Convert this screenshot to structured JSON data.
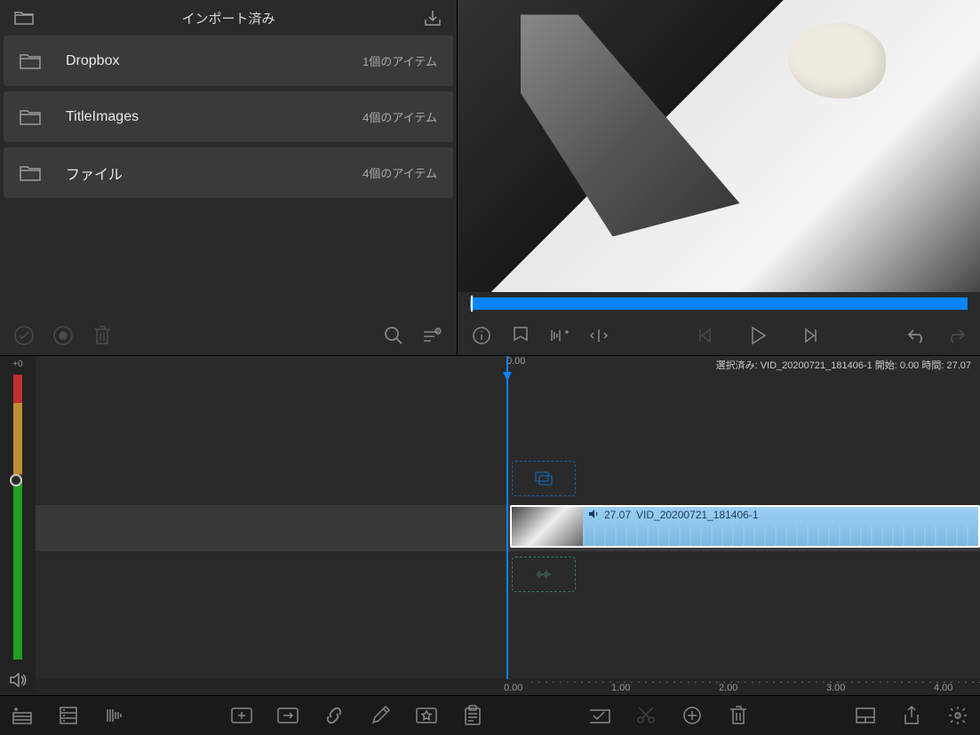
{
  "library": {
    "title": "インポート済み",
    "folders": [
      {
        "name": "Dropbox",
        "count": "1個のアイテム"
      },
      {
        "name": "TitleImages",
        "count": "4個のアイテム"
      },
      {
        "name": "ファイル",
        "count": "4個のアイテム"
      }
    ]
  },
  "timeline": {
    "gain_label": "+0",
    "playhead_time": "0.00",
    "status": "選択済み: VID_20200721_181406-1 開始: 0.00 時間: 27.07",
    "clip": {
      "duration": "27.07",
      "name": "VID_20200721_181406-1"
    },
    "ruler": [
      "0.00",
      "1.00",
      "2.00",
      "3.00",
      "4.00"
    ]
  }
}
